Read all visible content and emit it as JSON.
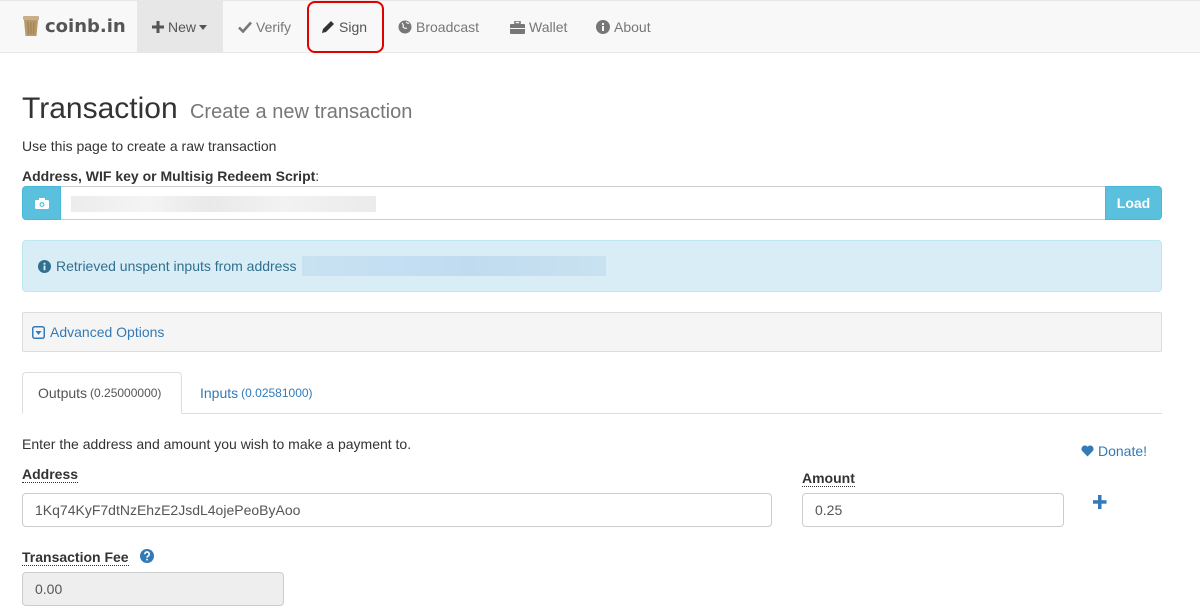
{
  "navbar": {
    "brand": "coinb.in",
    "items": [
      {
        "label": "New",
        "icon": "plus-icon"
      },
      {
        "label": "Verify",
        "icon": "check-icon"
      },
      {
        "label": "Sign",
        "icon": "pencil-icon"
      },
      {
        "label": "Broadcast",
        "icon": "globe-icon"
      },
      {
        "label": "Wallet",
        "icon": "briefcase-icon"
      },
      {
        "label": "About",
        "icon": "info-icon"
      }
    ]
  },
  "page": {
    "title": "Transaction",
    "subtitle": "Create a new transaction",
    "intro": "Use this page to create a raw transaction",
    "address_label": "Address, WIF key or Multisig Redeem Script",
    "load_button": "Load"
  },
  "alert": {
    "text": "Retrieved unspent inputs from address"
  },
  "advanced": {
    "label": "Advanced Options"
  },
  "tabs": [
    {
      "label": "Outputs",
      "value": "(0.25000000)",
      "active": true
    },
    {
      "label": "Inputs",
      "value": "(0.02581000)",
      "active": false
    }
  ],
  "outputs": {
    "intro": "Enter the address and amount you wish to make a payment to.",
    "donate": "Donate!",
    "address_label": "Address",
    "address_value": "1Kq74KyF7dtNzEhzE2JsdL4ojePeoByAoo",
    "amount_label": "Amount",
    "amount_value": "0.25",
    "fee_label": "Transaction Fee",
    "fee_value": "0.00"
  },
  "colors": {
    "info": "#5bc0de",
    "link": "#337ab7",
    "alert_bg": "#d9edf7",
    "highlight": "#e00000"
  }
}
